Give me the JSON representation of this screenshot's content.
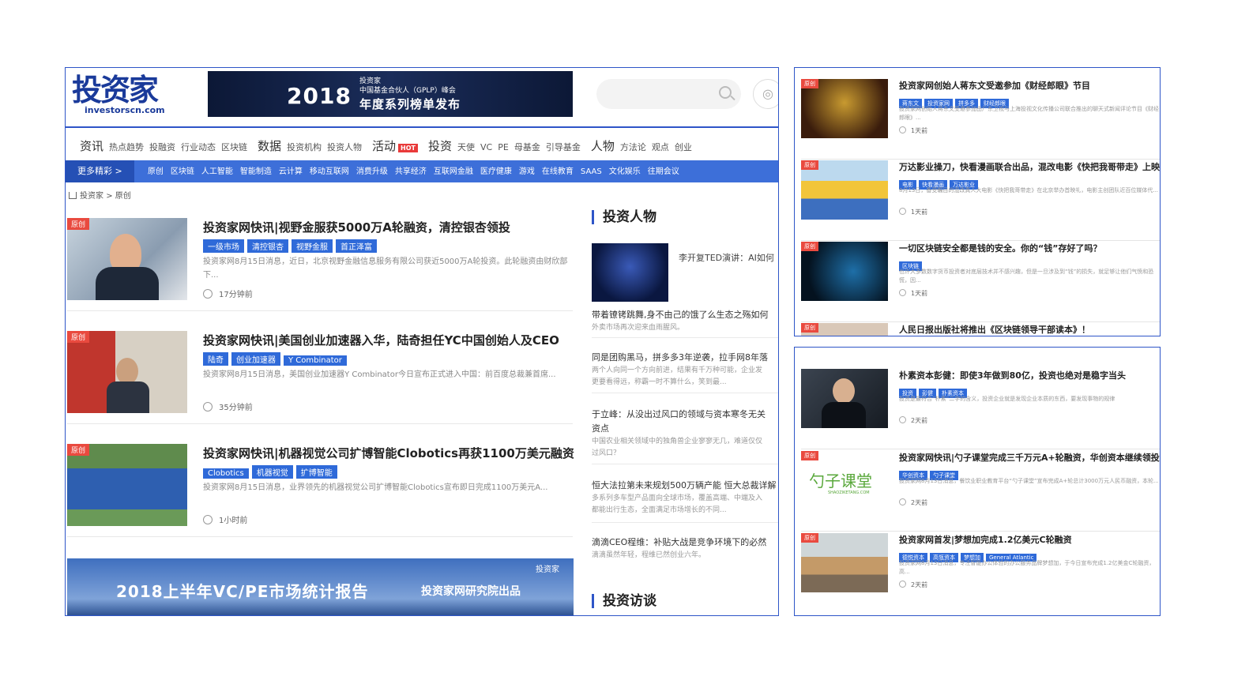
{
  "header": {
    "logo_cn": "投资家",
    "logo_en": "investorscn.com",
    "banner_logo": "投资家",
    "banner_year": "2018",
    "banner_line1": "中国基金合伙人（GPLP）峰会",
    "banner_line2": "年度系列榜单发布",
    "search_icon": "search-icon",
    "weibo_icon": "weibo-icon"
  },
  "nav1": {
    "groups": [
      {
        "cat": "资讯",
        "items": [
          "热点趋势",
          "投融资",
          "行业动态",
          "区块链"
        ]
      },
      {
        "cat": "数据",
        "items": [
          "投资机构",
          "投资人物"
        ]
      },
      {
        "cat": "活动",
        "hot": "HOT",
        "items": []
      },
      {
        "cat": "投资",
        "items": [
          "天使",
          "VC",
          "PE",
          "母基金",
          "引导基金"
        ]
      },
      {
        "cat": "人物",
        "items": [
          "方法论",
          "观点",
          "创业"
        ]
      }
    ]
  },
  "nav2": {
    "more": "更多精彩 >",
    "items": [
      "原创",
      "区块链",
      "人工智能",
      "智能制造",
      "云计算",
      "移动互联网",
      "消费升级",
      "共享经济",
      "互联网金融",
      "医疗健康",
      "游戏",
      "在线教育",
      "SAAS",
      "文化娱乐",
      "往期会议"
    ]
  },
  "breadcrumb": {
    "home": "投资家",
    "sep": ">",
    "current": "原创"
  },
  "articles": [
    {
      "badge": "原创",
      "title": "投资家网快讯|视野金服获5000万A轮融资，清控银杏领投",
      "tags": [
        "一级市场",
        "清控银杏",
        "视野金服",
        "首正泽富"
      ],
      "desc": "投资家网8月15日消息，近日，北京视野金融信息服务有限公司获近5000万A轮投资。此轮融资由财欣部下...",
      "time": "17分钟前"
    },
    {
      "badge": "原创",
      "title": "投资家网快讯|美国创业加速器入华，陆奇担任YC中国创始人及CEO",
      "tags": [
        "陆奇",
        "创业加速器",
        "Y Combinator"
      ],
      "desc": "投资家网8月15日消息，美国创业加速器Y Combinator今日宣布正式进入中国：前百度总裁兼首席...",
      "time": "35分钟前"
    },
    {
      "badge": "原创",
      "title": "投资家网快讯|机器视觉公司扩博智能Clobotics再获1100万美元融资",
      "tags": [
        "Clobotics",
        "机器视觉",
        "扩博智能"
      ],
      "desc": "投资家网8月15日消息，业界领先的机器视觉公司扩博智能Clobotics宣布即日完成1100万美元A...",
      "time": "1小时前"
    }
  ],
  "bottom_banner": {
    "title": "2018上半年VC/PE市场统计报告",
    "sub": "投资家网研究院出品",
    "logo": "投资家"
  },
  "side": {
    "head1": "投资人物",
    "person_caption": "李开复TED演讲：AI如何",
    "items": [
      {
        "title": "带着镣铐跳舞,身不由己的饿了么生态之殇如何",
        "desc": "外卖市场再次迎来血雨腥风。"
      },
      {
        "title": "同是团购黑马，拼多多3年逆袭，拉手网8年落",
        "desc": "两个人向同一个方向前进，结果有千万种可能，企业发",
        "desc2": "更要看得远，称霸一时不算什么，笑到最..."
      },
      {
        "title": "于立峰：从没出过风口的领域与资本寒冬无关",
        "title2": "资点",
        "desc": "中国农业相关领域中的独角兽企业寥寥无几，难道仅仅",
        "desc2": "过风口？"
      },
      {
        "title": "恒大法拉第未来规划500万辆产能 恒大总裁详解",
        "desc": "多系列多车型产品面向全球市场，覆盖高端、中端及入",
        "desc2": "都能出行生态，全面满足市场增长的不同..."
      },
      {
        "title": "滴滴CEO程维：补贴大战是竞争环境下的必然",
        "desc": "滴滴虽然年轻，程维已然创业六年。"
      }
    ],
    "head2": "投资访谈"
  },
  "right1": [
    {
      "badge": "原创",
      "title": "投资家网创始人蒋东文受邀参加《财经郎眼》节目",
      "tags": [
        "蒋东文",
        "投资家网",
        "拼多多",
        "财经郎眼"
      ],
      "desc": "投资家网创始人蒋东文受邀参加由广东卫视与上海投视文化传播公司联合推出的聊天式新闻评论节目《财经郎眼》...",
      "time": "1天前"
    },
    {
      "badge": "原创",
      "title": "万达影业操刀，快看漫画联合出品，混改电影《快把我哥带走》上映",
      "tags": [
        "电影",
        "快看漫画",
        "万达影业"
      ],
      "desc": "8月13日，备受瞩目的混改真人大电影《快把我哥带走》在北京举办首映礼，电影主创团队近百位媒体代...",
      "time": "1天前"
    },
    {
      "badge": "原创",
      "title": "一切区块链安全都是钱的安全。你的“钱”存好了吗？",
      "tags": [
        "区块链"
      ],
      "desc": "也许大多数数字货币投资者对底层技术并不感兴趣，但是一旦涉及到“钱”的损失，就足够让他们气愤和恐慌，因...",
      "time": "1天前"
    },
    {
      "badge": "原创",
      "title": "人民日报出版社将推出《区块链领导干部读本》！",
      "tags": [],
      "desc": "",
      "time": ""
    }
  ],
  "right2": [
    {
      "badge": "",
      "title": "朴素资本彭健：即使3年做到80亿，投资也绝对是稳字当头",
      "tags": [
        "投资",
        "彭健",
        "朴素资本"
      ],
      "desc": "投资是最符合“朴素”二字的含义，投资企业就是发现企业本质的东西，要发现事物的规律",
      "time": "2天前"
    },
    {
      "badge": "原创",
      "title": "投资家网快讯|勺子课堂完成三千万元A+轮融资，华创资本继续领投",
      "tags": [
        "华创资本",
        "勺子课堂"
      ],
      "desc": "投资家网8月13日消息，餐饮业职业教育平台“勺子课堂”宣布完成A+轮总计3000万元人民币融资，本轮...",
      "time": "2天前",
      "logo_text": "勺子课堂",
      "logo_sub": "SHAOZIKETANG.COM"
    },
    {
      "badge": "原创",
      "title": "投资家网首发|梦想加完成1.2亿美元C轮融资",
      "tags": [
        "德悦资本",
        "高瓴资本",
        "梦想加",
        "General Atlantic"
      ],
      "desc": "投资家网8月13日消息，专注智能办公体验的办公服务品牌梦想加，于今日宣布完成1.2亿美金C轮融资，高...",
      "time": "2天前"
    }
  ],
  "colors": {
    "accent": "#2e55c8",
    "tag": "#2f6ad9",
    "badge": "#e94a3f"
  }
}
